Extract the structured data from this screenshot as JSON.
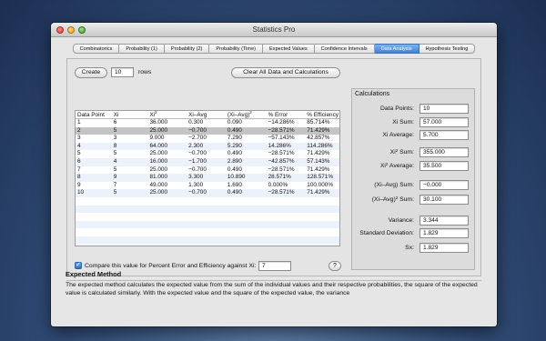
{
  "window": {
    "title": "Statistics Pro"
  },
  "tabs": [
    {
      "label": "Combinatorics",
      "active": false
    },
    {
      "label": "Probability (1)",
      "active": false
    },
    {
      "label": "Probability (2)",
      "active": false
    },
    {
      "label": "Probability (Time)",
      "active": false
    },
    {
      "label": "Expected Values",
      "active": false
    },
    {
      "label": "Confidence Intervals",
      "active": false
    },
    {
      "label": "Data Analysis",
      "active": true
    },
    {
      "label": "Hypothesis Testing",
      "active": false
    }
  ],
  "controls": {
    "create_label": "Create",
    "rows_value": "10",
    "rows_label": "rows",
    "clear_label": "Clear All Data and Calculations",
    "compare_label": "Compare this value for Percent Error and Efficiency against Xi:",
    "compare_checked": true,
    "compare_value": "7",
    "help_label": "?"
  },
  "table": {
    "headers": [
      {
        "text": "Data Point",
        "sup": ""
      },
      {
        "text": "Xi",
        "sup": ""
      },
      {
        "text": "Xi",
        "sup": "2"
      },
      {
        "text": "Xi–Avg",
        "sup": ""
      },
      {
        "text": "(Xi–Avg)",
        "sup": "2"
      },
      {
        "text": "% Error",
        "sup": ""
      },
      {
        "text": "% Efficiency",
        "sup": ""
      }
    ],
    "selected_row": 1,
    "rows": [
      [
        "1",
        "6",
        "36.000",
        "0.300",
        "0.090",
        "−14.286%",
        "85.714%"
      ],
      [
        "2",
        "5",
        "25.000",
        "−0.700",
        "0.490",
        "−28.571%",
        "71.429%"
      ],
      [
        "3",
        "3",
        "9.000",
        "−2.700",
        "7.290",
        "−57.143%",
        "42.857%"
      ],
      [
        "4",
        "8",
        "64.000",
        "2.300",
        "5.290",
        "14.286%",
        "114.286%"
      ],
      [
        "5",
        "5",
        "25.000",
        "−0.700",
        "0.490",
        "−28.571%",
        "71.429%"
      ],
      [
        "6",
        "4",
        "16.000",
        "−1.700",
        "2.890",
        "−42.857%",
        "57.143%"
      ],
      [
        "7",
        "5",
        "25.000",
        "−0.700",
        "0.490",
        "−28.571%",
        "71.429%"
      ],
      [
        "8",
        "9",
        "81.000",
        "3.300",
        "10.890",
        "28.571%",
        "128.571%"
      ],
      [
        "9",
        "7",
        "49.000",
        "1.300",
        "1.690",
        "0.000%",
        "100.000%"
      ],
      [
        "10",
        "5",
        "25.000",
        "−0.700",
        "0.490",
        "−28.571%",
        "71.429%"
      ]
    ],
    "empty_rows": 6
  },
  "calculations": {
    "title": "Calculations",
    "items": [
      {
        "label": "Data Points:",
        "sup": "",
        "after": "",
        "value": "10"
      },
      {
        "label": "Xi Sum:",
        "sup": "",
        "after": "",
        "value": "57.000"
      },
      {
        "label": "Xi Average:",
        "sup": "",
        "after": "",
        "value": "5.700"
      },
      {
        "label": "Xi",
        "sup": "2",
        "after": " Sum:",
        "value": "355.000"
      },
      {
        "label": "Xi",
        "sup": "2",
        "after": " Average:",
        "value": "35.500"
      },
      {
        "label": "(Xi–Avg) Sum:",
        "sup": "",
        "after": "",
        "value": "−0.000"
      },
      {
        "label": "(Xi–Avg)",
        "sup": "2",
        "after": " Sum:",
        "value": "30.100"
      },
      {
        "label": "Variance:",
        "sup": "",
        "after": "",
        "value": "3.344"
      },
      {
        "label": "Standard Deviation:",
        "sup": "",
        "after": "",
        "value": "1.829"
      },
      {
        "label": "Sx:",
        "sup": "",
        "after": "",
        "value": "1.829"
      }
    ]
  },
  "expected": {
    "title": "Expected Method",
    "text": "The expected method calculates the expected value from the sum of the individual values and their respective probabilities, the square of the expected value is calculated similarly.  With the expected value and the square of the expected value, the variance"
  }
}
